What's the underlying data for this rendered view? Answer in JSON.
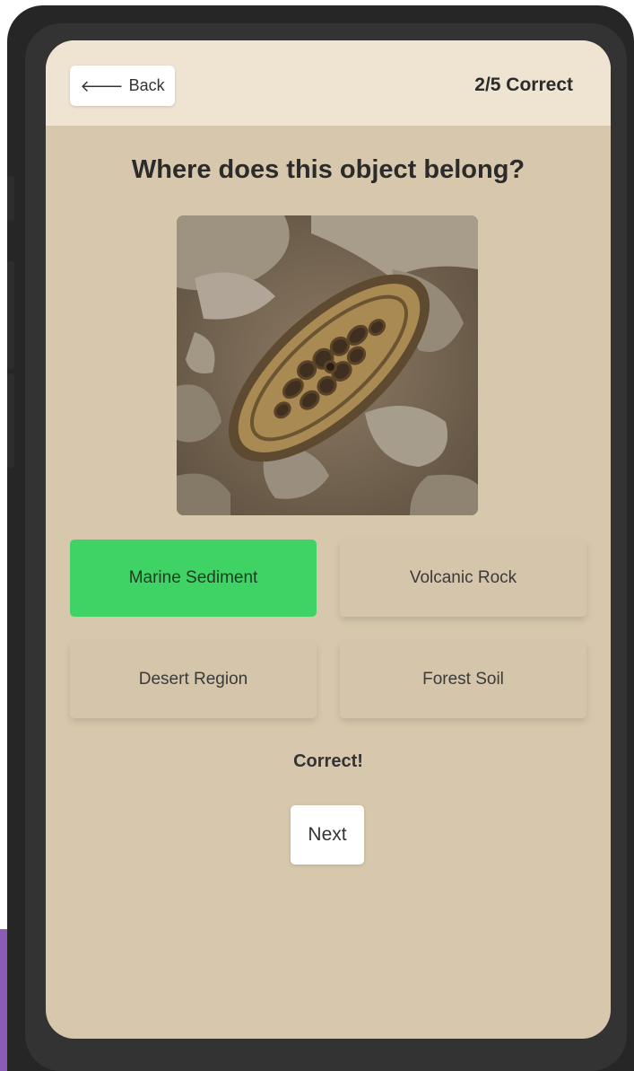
{
  "header": {
    "back_label": "Back",
    "score": "2/5 Correct"
  },
  "quiz": {
    "question": "Where does this object belong?",
    "image_subject": "fossil-in-rock",
    "options": [
      {
        "label": "Marine Sediment",
        "state": "correct"
      },
      {
        "label": "Volcanic Rock",
        "state": "default"
      },
      {
        "label": "Desert Region",
        "state": "default"
      },
      {
        "label": "Forest Soil",
        "state": "default"
      }
    ],
    "result": "Correct!",
    "next_label": "Next"
  },
  "colors": {
    "screen_bg": "#d7c8ad",
    "header_bg": "#efe3d2",
    "correct": "#3fd366",
    "device_frame": "#262626"
  }
}
